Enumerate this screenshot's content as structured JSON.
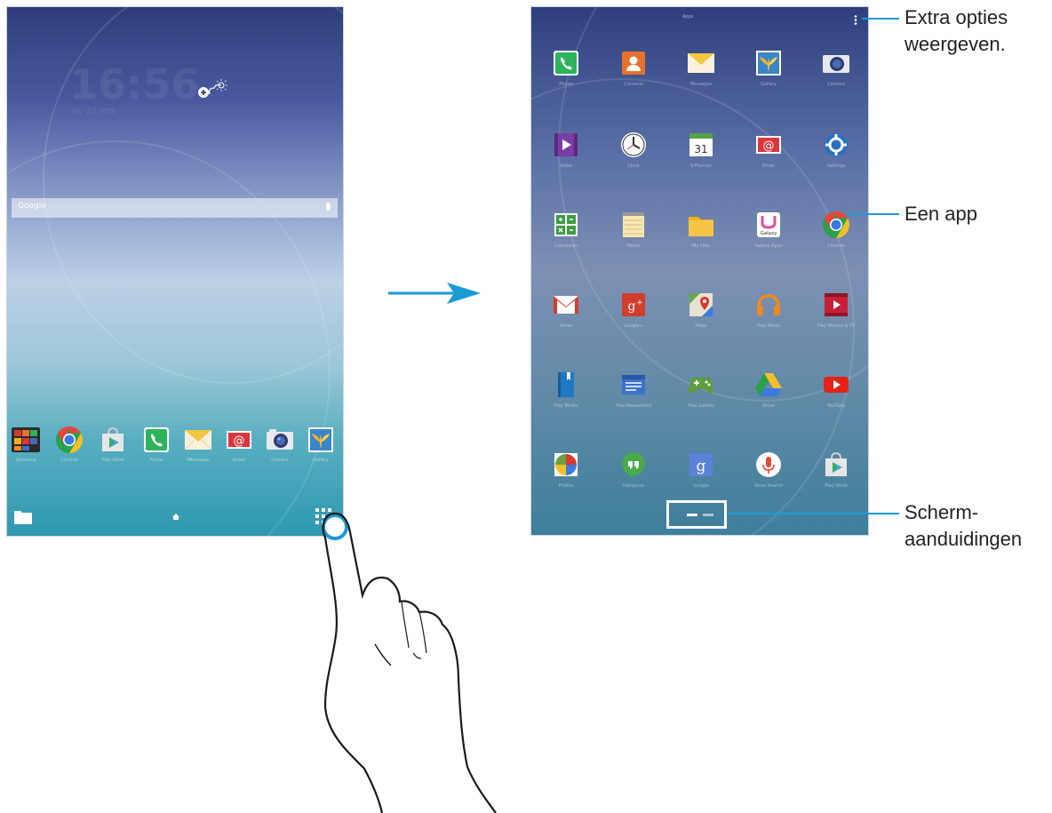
{
  "left_screen": {
    "title": "home-screen",
    "clock_time": "16:56",
    "clock_date": "vr, 20 mrt",
    "search_placeholder": "Google",
    "dock": [
      {
        "name": "samsung-apps",
        "label": "Samsung"
      },
      {
        "name": "chrome",
        "label": "Chrome"
      },
      {
        "name": "play-store",
        "label": "Play Store"
      },
      {
        "name": "phone",
        "label": "Phone"
      },
      {
        "name": "messages",
        "label": "Messages"
      },
      {
        "name": "email",
        "label": "Email"
      },
      {
        "name": "camera",
        "label": "Camera"
      },
      {
        "name": "gallery",
        "label": "Gallery"
      }
    ]
  },
  "right_screen": {
    "title": "Apps",
    "apps": [
      {
        "name": "phone",
        "label": "Phone",
        "color": "#2eb35d"
      },
      {
        "name": "contacts",
        "label": "Contacts",
        "color": "#e8722c"
      },
      {
        "name": "messages",
        "label": "Messages",
        "color": "#f3c743"
      },
      {
        "name": "gallery",
        "label": "Gallery",
        "color": "#f1b72a"
      },
      {
        "name": "camera",
        "label": "Camera",
        "color": "#4b6ab5"
      },
      {
        "name": "video",
        "label": "Video",
        "color": "#7a3ca6"
      },
      {
        "name": "clock",
        "label": "Clock",
        "color": "#ffffff"
      },
      {
        "name": "s-planner",
        "label": "S Planner",
        "color": "#58a047"
      },
      {
        "name": "email",
        "label": "Email",
        "color": "#d9363e"
      },
      {
        "name": "settings",
        "label": "Settings",
        "color": "#2a6fc1"
      },
      {
        "name": "calculator",
        "label": "Calculator",
        "color": "#3f9c45"
      },
      {
        "name": "memo",
        "label": "Memo",
        "color": "#f7e8b0"
      },
      {
        "name": "my-files",
        "label": "My Files",
        "color": "#f5b11a"
      },
      {
        "name": "galaxy-apps",
        "label": "Galaxy Apps",
        "color": "#e24f94"
      },
      {
        "name": "chrome",
        "label": "Chrome",
        "color": "#e8453c"
      },
      {
        "name": "gmail",
        "label": "Gmail",
        "color": "#d93a2f"
      },
      {
        "name": "google-plus",
        "label": "Google+",
        "color": "#d23e2c"
      },
      {
        "name": "maps",
        "label": "Maps",
        "color": "#66a848"
      },
      {
        "name": "play-music",
        "label": "Play Music",
        "color": "#f08a1f"
      },
      {
        "name": "play-movies",
        "label": "Play Movies & TV",
        "color": "#c72036"
      },
      {
        "name": "play-books",
        "label": "Play Books",
        "color": "#1f78c4"
      },
      {
        "name": "play-newsstand",
        "label": "Play Newsstand",
        "color": "#3c72cf"
      },
      {
        "name": "play-games",
        "label": "Play Games",
        "color": "#5d9d3c"
      },
      {
        "name": "drive",
        "label": "Drive",
        "color": "#2aa04b"
      },
      {
        "name": "youtube",
        "label": "YouTube",
        "color": "#e62117"
      },
      {
        "name": "photos",
        "label": "Photos",
        "color": "#6a9e3f"
      },
      {
        "name": "hangouts",
        "label": "Hangouts",
        "color": "#49a94b"
      },
      {
        "name": "google",
        "label": "Google",
        "color": "#5a83d8"
      },
      {
        "name": "voice-search",
        "label": "Voice Search",
        "color": "#e24a3c"
      },
      {
        "name": "play-store",
        "label": "Play Store",
        "color": "#47a4d7"
      }
    ]
  },
  "callouts": {
    "menu": "Extra opties weergeven.",
    "app": "Een app",
    "pager_line1": "Scherm-",
    "pager_line2": "aanduidingen"
  },
  "colors": {
    "arrow": "#1b9bd6",
    "callout_line": "#1b9bd6",
    "text": "#231f20"
  }
}
